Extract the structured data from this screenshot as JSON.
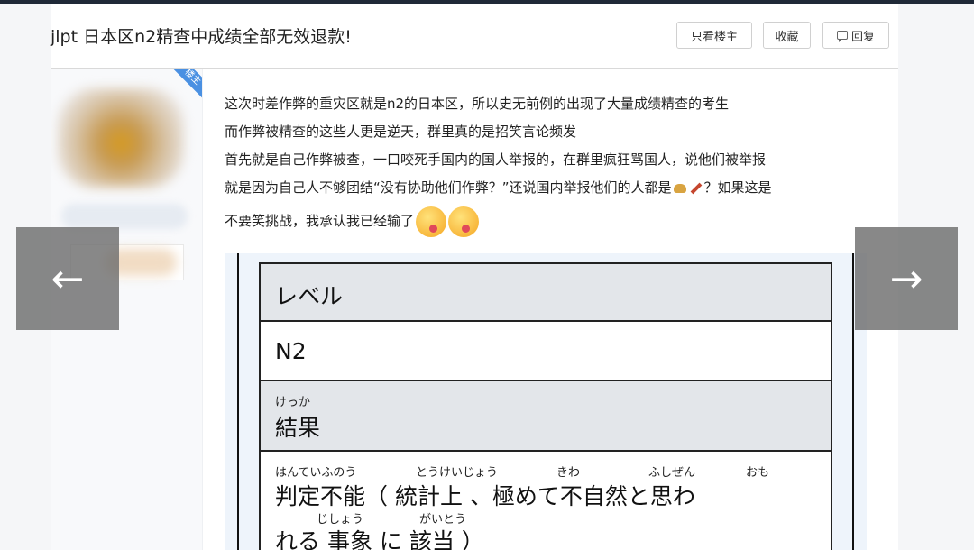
{
  "thread": {
    "title": "jlpt 日本区n2精查中成绩全部无效退款!",
    "actions": {
      "only_op": "只看楼主",
      "favorite": "收藏",
      "reply": "回复"
    }
  },
  "author": {
    "op_badge": "楼主"
  },
  "post": {
    "lines": [
      "这次时差作弊的重灾区就是n2的日本区，所以史无前例的出现了大量成绩精查的考生",
      "而作弊被精查的这些人更是逆天，群里真的是招笑言论频发",
      "首先就是自己作弊被查，一口咬死手国内的国人举报的，在群里疯狂骂国人，说他们被举报",
      "就是因为自己人不够团结“没有协助他们作弊？”还说国内举报他们的人都是",
      "？如果这是",
      "不要笑挑战，我承认我已经输了"
    ],
    "emoji": [
      "burger-emoji",
      "rocket-emoji",
      "yum-emoji",
      "yum-emoji"
    ]
  },
  "image": {
    "level_header": "レベル",
    "level_value": "N2",
    "result_furigana": "けっか",
    "result_header": "結果",
    "verdict_furigana_1": "はんていふのう",
    "verdict_furigana_2": "とうけいじょう",
    "verdict_furigana_3": "きわ",
    "verdict_furigana_4": "ふしぜん",
    "verdict_furigana_5": "おも",
    "verdict_line_1": "判定不能（ 統計上 、極めて不自然と思わ",
    "verdict_furigana_6": "じしょう",
    "verdict_furigana_7": "がいとう",
    "verdict_line_2": "れる 事象 に 該当 ）"
  },
  "nav": {
    "prev_icon": "arrow-left-icon",
    "next_icon": "arrow-right-icon",
    "prev_glyph": "←",
    "next_glyph": "→"
  }
}
